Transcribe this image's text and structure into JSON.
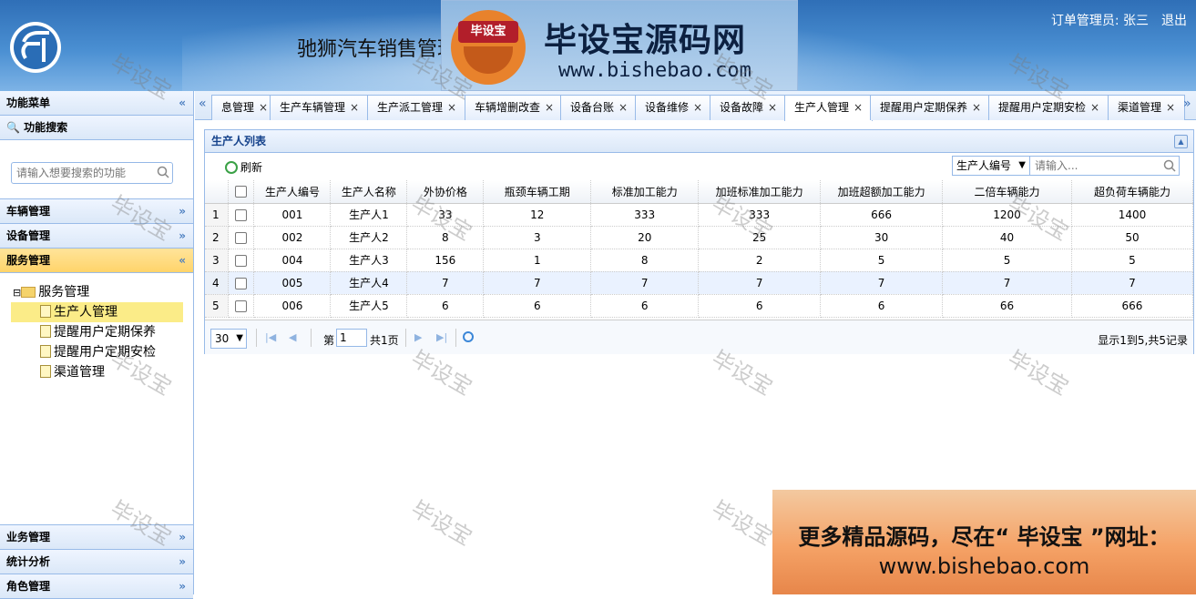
{
  "header": {
    "app_title": "驰狮汽车销售管理系统",
    "user_label": "订单管理员: 张三",
    "logout": "退出",
    "brand_badge": "毕设宝",
    "brand_name": "毕设宝源码网",
    "brand_url": "www.bishebao.com"
  },
  "sidebar": {
    "menu_title": "功能菜单",
    "search_title": "功能搜索",
    "search_placeholder": "请输入想要搜索的功能",
    "sections_top": [
      "车辆管理",
      "设备管理",
      "服务管理"
    ],
    "tree": {
      "root": "服务管理",
      "children": [
        "生产人管理",
        "提醒用户定期保养",
        "提醒用户定期安检",
        "渠道管理"
      ]
    },
    "sections_bottom": [
      "业务管理",
      "统计分析",
      "角色管理"
    ]
  },
  "tabs": [
    "息管理",
    "生产车辆管理",
    "生产派工管理",
    "车辆增删改查",
    "设备台账",
    "设备维修",
    "设备故障",
    "生产人管理",
    "提醒用户定期保养",
    "提醒用户定期安检",
    "渠道管理"
  ],
  "active_tab": "生产人管理",
  "grid": {
    "title": "生产人列表",
    "refresh": "刷新",
    "search_field": "生产人编号",
    "search_placeholder": "请输入...",
    "columns": [
      "生产人编号",
      "生产人名称",
      "外协价格",
      "瓶颈车辆工期",
      "标准加工能力",
      "加班标准加工能力",
      "加班超额加工能力",
      "二倍车辆能力",
      "超负荷车辆能力"
    ],
    "rows": [
      [
        "1",
        "001",
        "生产人1",
        "33",
        "12",
        "333",
        "333",
        "666",
        "1200",
        "1400"
      ],
      [
        "2",
        "002",
        "生产人2",
        "8",
        "3",
        "20",
        "25",
        "30",
        "40",
        "50"
      ],
      [
        "3",
        "004",
        "生产人3",
        "156",
        "1",
        "8",
        "2",
        "5",
        "5",
        "5"
      ],
      [
        "4",
        "005",
        "生产人4",
        "7",
        "7",
        "7",
        "7",
        "7",
        "7",
        "7"
      ],
      [
        "5",
        "006",
        "生产人5",
        "6",
        "6",
        "6",
        "6",
        "6",
        "66",
        "666"
      ]
    ],
    "pager": {
      "page_size": "30",
      "page_prefix": "第",
      "page_value": "1",
      "page_total": "共1页",
      "info": "显示1到5,共5记录"
    }
  },
  "watermark": "毕设宝",
  "promo": {
    "line1": "更多精品源码，尽在“ 毕设宝 ”网址：",
    "line2": "www.bishebao.com"
  }
}
